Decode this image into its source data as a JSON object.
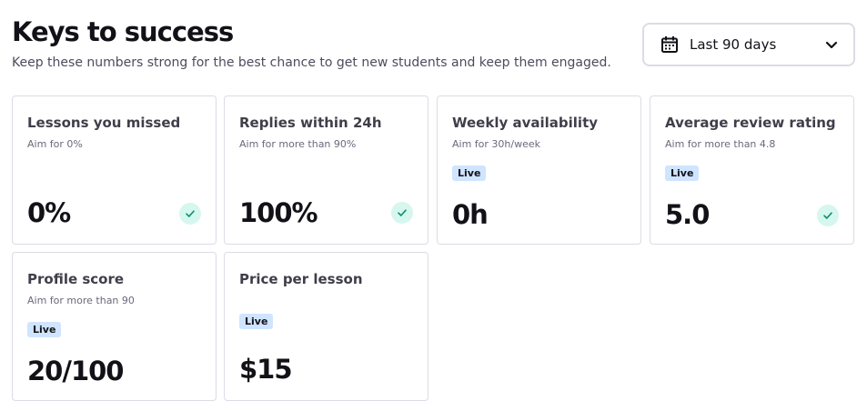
{
  "header": {
    "title": "Keys to success",
    "subtitle": "Keep these numbers strong for the best chance to get new students and keep them engaged."
  },
  "period_select": {
    "icon": "calendar-icon",
    "label": "Last 90 days"
  },
  "cards": [
    {
      "name": "Lessons you missed",
      "aim": "Aim for 0%",
      "value": "0%",
      "live": false,
      "checked": true
    },
    {
      "name": "Replies within 24h",
      "aim": "Aim for more than 90%",
      "value": "100%",
      "live": false,
      "checked": true
    },
    {
      "name": "Weekly availability",
      "aim": "Aim for 30h/week",
      "value": "0h",
      "live": true,
      "checked": false
    },
    {
      "name": "Average review rating",
      "aim": "Aim for more than 4.8",
      "value": "5.0",
      "live": true,
      "checked": true
    },
    {
      "name": "Profile score",
      "aim": "Aim for more than 90",
      "value": "20/100",
      "live": true,
      "checked": false
    },
    {
      "name": "Price per lesson",
      "value": "$15",
      "live": true,
      "checked": false
    }
  ],
  "badge_label": "Live",
  "colors": {
    "badge_bg": "#cfe4ff",
    "check_bg": "#d6f7ee",
    "check_mark": "#0e8f6e",
    "border": "#dcdce5"
  }
}
